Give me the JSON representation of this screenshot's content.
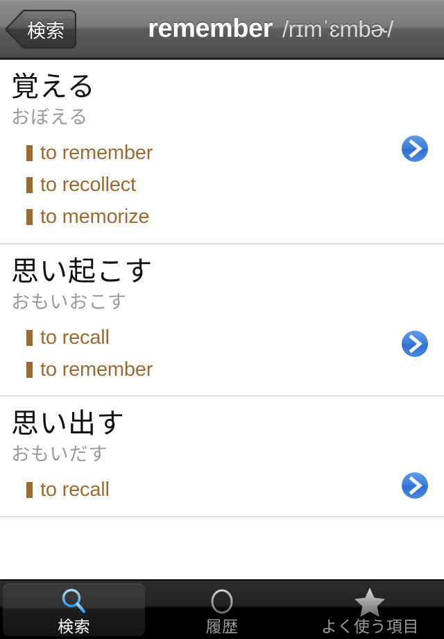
{
  "navbar": {
    "back_label": "検索",
    "back_icon": "chevron-left-icon",
    "title": "remember",
    "phonetic": "/rɪmˈɛmbɚ/"
  },
  "colors": {
    "sense_brown": "#9d6a33",
    "reading_gray": "#9a9a9a",
    "accent_blue": "#3b82dd",
    "divider": "#dcdcdc"
  },
  "entries": [
    {
      "headword": "覚える",
      "reading": "おぼえる",
      "senses": [
        "to remember",
        "to recollect",
        "to memorize"
      ],
      "disclosure_icon": "chevron-right-circle-icon"
    },
    {
      "headword": "思い起こす",
      "reading": "おもいおこす",
      "senses": [
        "to recall",
        "to remember"
      ],
      "disclosure_icon": "chevron-right-circle-icon"
    },
    {
      "headword": "思い出す",
      "reading": "おもいだす",
      "senses": [
        "to recall"
      ],
      "disclosure_icon": "chevron-right-circle-icon"
    }
  ],
  "tabbar": {
    "items": [
      {
        "label": "検索",
        "icon": "search-magnifier-icon",
        "active": true
      },
      {
        "label": "履歴",
        "icon": "clock-history-icon",
        "active": false
      },
      {
        "label": "よく使う項目",
        "icon": "star-favorites-icon",
        "active": false
      }
    ]
  }
}
